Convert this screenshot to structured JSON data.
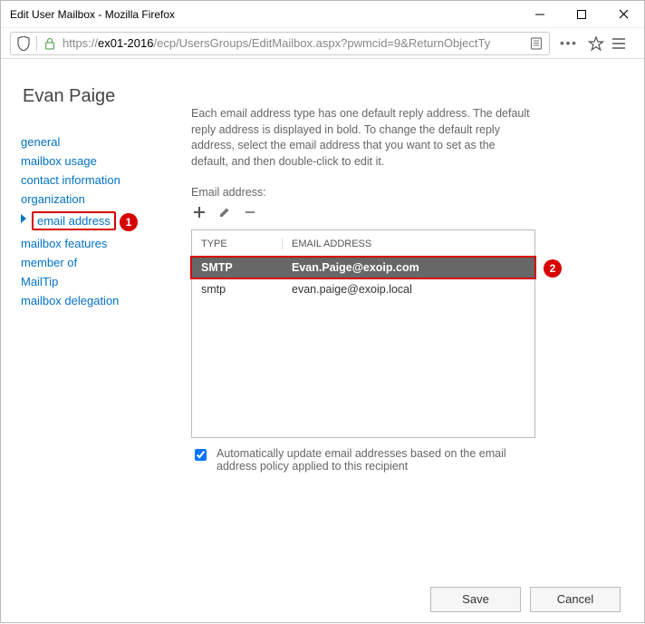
{
  "window": {
    "title": "Edit User Mailbox - Mozilla Firefox"
  },
  "url": {
    "host": "ex01-2016",
    "path": "/ecp/UsersGroups/EditMailbox.aspx?pwmcid=9&ReturnObjectTy",
    "prefix": "https://"
  },
  "page": {
    "user": "Evan Paige",
    "nav": [
      "general",
      "mailbox usage",
      "contact information",
      "organization",
      "email address",
      "mailbox features",
      "member of",
      "MailTip",
      "mailbox delegation"
    ],
    "nav_active_index": 4,
    "callouts": {
      "nav": "1",
      "row": "2"
    },
    "description": "Each email address type has one default reply address. The default reply address is displayed in bold. To change the default reply address, select the email address that you want to set as the default, and then double-click to edit it.",
    "email_label": "Email address:",
    "columns": {
      "type": "TYPE",
      "addr": "EMAIL ADDRESS"
    },
    "rows": [
      {
        "type": "SMTP",
        "addr": "Evan.Paige@exoip.com",
        "selected": true
      },
      {
        "type": "smtp",
        "addr": "evan.paige@exoip.local",
        "selected": false
      }
    ],
    "auto_update": {
      "checked": true,
      "label": "Automatically update email addresses based on the email address policy applied to this recipient"
    },
    "buttons": {
      "save": "Save",
      "cancel": "Cancel"
    }
  }
}
